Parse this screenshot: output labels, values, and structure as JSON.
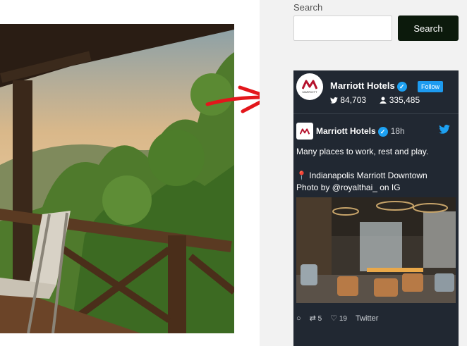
{
  "sidebar": {
    "search_label": "Search",
    "search_placeholder": "",
    "search_button": "Search"
  },
  "widget": {
    "name": "Marriott Hotels",
    "follow_label": "Follow",
    "tweets_count": "84,703",
    "followers_count": "335,485",
    "avatar_text": "MARRIOTT"
  },
  "tweet": {
    "author": "Marriott Hotels",
    "time": "18h",
    "line1": "Many places to work, rest and play.",
    "line2": "Indianapolis Marriott Downtown",
    "line3": "Photo by @royalthai_ on IG",
    "retweets": "5",
    "likes": "19",
    "source": "Twitter"
  },
  "icons": {
    "verified": "verified-check-icon",
    "bird": "twitter-bird-icon",
    "pin": "location-pin-icon",
    "reply": "reply-icon",
    "retweet": "retweet-icon",
    "like": "heart-icon",
    "user": "user-icon",
    "arrow": "red-arrow-icon"
  },
  "colors": {
    "widget_bg": "#212832",
    "search_button": "#0c1a0c",
    "follow": "#1d9bf0",
    "twitter_blue": "#1da1f2",
    "arrow": "#e3161b",
    "marriott_red": "#b5122d"
  }
}
